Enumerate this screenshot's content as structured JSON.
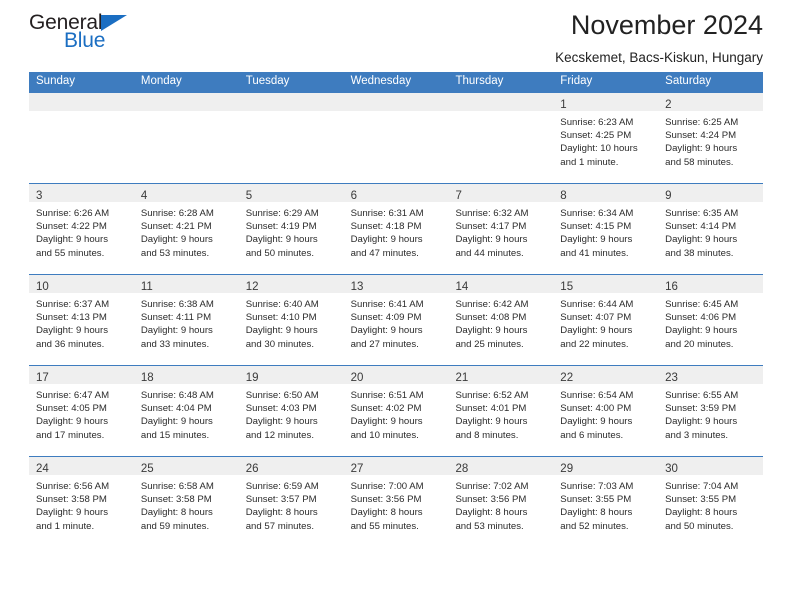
{
  "logo": {
    "part1": "General",
    "part2": "Blue",
    "triangle_icon": "blue-triangle-icon"
  },
  "header": {
    "title": "November 2024",
    "subtitle": "Kecskemet, Bacs-Kiskun, Hungary"
  },
  "colors": {
    "header_blue": "#3e7cbf",
    "daynum_band": "#efefef",
    "logo_blue": "#1b6ec2",
    "text": "#2b2b2b"
  },
  "calendar": {
    "weekdays": [
      "Sunday",
      "Monday",
      "Tuesday",
      "Wednesday",
      "Thursday",
      "Friday",
      "Saturday"
    ],
    "weeks": [
      [
        {
          "day": ""
        },
        {
          "day": ""
        },
        {
          "day": ""
        },
        {
          "day": ""
        },
        {
          "day": ""
        },
        {
          "day": "1",
          "sunrise": "Sunrise: 6:23 AM",
          "sunset": "Sunset: 4:25 PM",
          "daylight1": "Daylight: 10 hours",
          "daylight2": "and 1 minute."
        },
        {
          "day": "2",
          "sunrise": "Sunrise: 6:25 AM",
          "sunset": "Sunset: 4:24 PM",
          "daylight1": "Daylight: 9 hours",
          "daylight2": "and 58 minutes."
        }
      ],
      [
        {
          "day": "3",
          "sunrise": "Sunrise: 6:26 AM",
          "sunset": "Sunset: 4:22 PM",
          "daylight1": "Daylight: 9 hours",
          "daylight2": "and 55 minutes."
        },
        {
          "day": "4",
          "sunrise": "Sunrise: 6:28 AM",
          "sunset": "Sunset: 4:21 PM",
          "daylight1": "Daylight: 9 hours",
          "daylight2": "and 53 minutes."
        },
        {
          "day": "5",
          "sunrise": "Sunrise: 6:29 AM",
          "sunset": "Sunset: 4:19 PM",
          "daylight1": "Daylight: 9 hours",
          "daylight2": "and 50 minutes."
        },
        {
          "day": "6",
          "sunrise": "Sunrise: 6:31 AM",
          "sunset": "Sunset: 4:18 PM",
          "daylight1": "Daylight: 9 hours",
          "daylight2": "and 47 minutes."
        },
        {
          "day": "7",
          "sunrise": "Sunrise: 6:32 AM",
          "sunset": "Sunset: 4:17 PM",
          "daylight1": "Daylight: 9 hours",
          "daylight2": "and 44 minutes."
        },
        {
          "day": "8",
          "sunrise": "Sunrise: 6:34 AM",
          "sunset": "Sunset: 4:15 PM",
          "daylight1": "Daylight: 9 hours",
          "daylight2": "and 41 minutes."
        },
        {
          "day": "9",
          "sunrise": "Sunrise: 6:35 AM",
          "sunset": "Sunset: 4:14 PM",
          "daylight1": "Daylight: 9 hours",
          "daylight2": "and 38 minutes."
        }
      ],
      [
        {
          "day": "10",
          "sunrise": "Sunrise: 6:37 AM",
          "sunset": "Sunset: 4:13 PM",
          "daylight1": "Daylight: 9 hours",
          "daylight2": "and 36 minutes."
        },
        {
          "day": "11",
          "sunrise": "Sunrise: 6:38 AM",
          "sunset": "Sunset: 4:11 PM",
          "daylight1": "Daylight: 9 hours",
          "daylight2": "and 33 minutes."
        },
        {
          "day": "12",
          "sunrise": "Sunrise: 6:40 AM",
          "sunset": "Sunset: 4:10 PM",
          "daylight1": "Daylight: 9 hours",
          "daylight2": "and 30 minutes."
        },
        {
          "day": "13",
          "sunrise": "Sunrise: 6:41 AM",
          "sunset": "Sunset: 4:09 PM",
          "daylight1": "Daylight: 9 hours",
          "daylight2": "and 27 minutes."
        },
        {
          "day": "14",
          "sunrise": "Sunrise: 6:42 AM",
          "sunset": "Sunset: 4:08 PM",
          "daylight1": "Daylight: 9 hours",
          "daylight2": "and 25 minutes."
        },
        {
          "day": "15",
          "sunrise": "Sunrise: 6:44 AM",
          "sunset": "Sunset: 4:07 PM",
          "daylight1": "Daylight: 9 hours",
          "daylight2": "and 22 minutes."
        },
        {
          "day": "16",
          "sunrise": "Sunrise: 6:45 AM",
          "sunset": "Sunset: 4:06 PM",
          "daylight1": "Daylight: 9 hours",
          "daylight2": "and 20 minutes."
        }
      ],
      [
        {
          "day": "17",
          "sunrise": "Sunrise: 6:47 AM",
          "sunset": "Sunset: 4:05 PM",
          "daylight1": "Daylight: 9 hours",
          "daylight2": "and 17 minutes."
        },
        {
          "day": "18",
          "sunrise": "Sunrise: 6:48 AM",
          "sunset": "Sunset: 4:04 PM",
          "daylight1": "Daylight: 9 hours",
          "daylight2": "and 15 minutes."
        },
        {
          "day": "19",
          "sunrise": "Sunrise: 6:50 AM",
          "sunset": "Sunset: 4:03 PM",
          "daylight1": "Daylight: 9 hours",
          "daylight2": "and 12 minutes."
        },
        {
          "day": "20",
          "sunrise": "Sunrise: 6:51 AM",
          "sunset": "Sunset: 4:02 PM",
          "daylight1": "Daylight: 9 hours",
          "daylight2": "and 10 minutes."
        },
        {
          "day": "21",
          "sunrise": "Sunrise: 6:52 AM",
          "sunset": "Sunset: 4:01 PM",
          "daylight1": "Daylight: 9 hours",
          "daylight2": "and 8 minutes."
        },
        {
          "day": "22",
          "sunrise": "Sunrise: 6:54 AM",
          "sunset": "Sunset: 4:00 PM",
          "daylight1": "Daylight: 9 hours",
          "daylight2": "and 6 minutes."
        },
        {
          "day": "23",
          "sunrise": "Sunrise: 6:55 AM",
          "sunset": "Sunset: 3:59 PM",
          "daylight1": "Daylight: 9 hours",
          "daylight2": "and 3 minutes."
        }
      ],
      [
        {
          "day": "24",
          "sunrise": "Sunrise: 6:56 AM",
          "sunset": "Sunset: 3:58 PM",
          "daylight1": "Daylight: 9 hours",
          "daylight2": "and 1 minute."
        },
        {
          "day": "25",
          "sunrise": "Sunrise: 6:58 AM",
          "sunset": "Sunset: 3:58 PM",
          "daylight1": "Daylight: 8 hours",
          "daylight2": "and 59 minutes."
        },
        {
          "day": "26",
          "sunrise": "Sunrise: 6:59 AM",
          "sunset": "Sunset: 3:57 PM",
          "daylight1": "Daylight: 8 hours",
          "daylight2": "and 57 minutes."
        },
        {
          "day": "27",
          "sunrise": "Sunrise: 7:00 AM",
          "sunset": "Sunset: 3:56 PM",
          "daylight1": "Daylight: 8 hours",
          "daylight2": "and 55 minutes."
        },
        {
          "day": "28",
          "sunrise": "Sunrise: 7:02 AM",
          "sunset": "Sunset: 3:56 PM",
          "daylight1": "Daylight: 8 hours",
          "daylight2": "and 53 minutes."
        },
        {
          "day": "29",
          "sunrise": "Sunrise: 7:03 AM",
          "sunset": "Sunset: 3:55 PM",
          "daylight1": "Daylight: 8 hours",
          "daylight2": "and 52 minutes."
        },
        {
          "day": "30",
          "sunrise": "Sunrise: 7:04 AM",
          "sunset": "Sunset: 3:55 PM",
          "daylight1": "Daylight: 8 hours",
          "daylight2": "and 50 minutes."
        }
      ]
    ]
  }
}
